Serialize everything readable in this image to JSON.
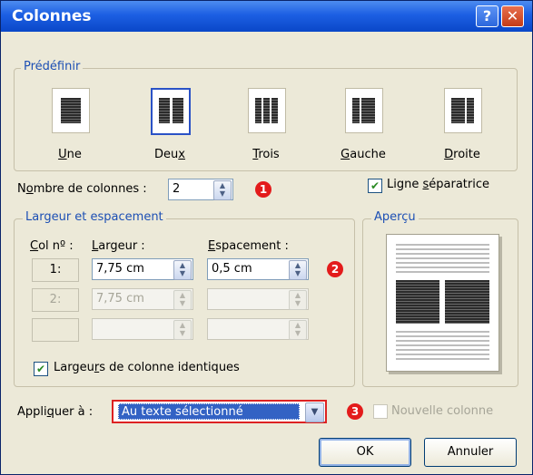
{
  "window": {
    "title": "Colonnes",
    "help_label": "?",
    "close_label": "✕"
  },
  "presets": {
    "group_title": "Prédéfinir",
    "items": [
      {
        "label_u": "U",
        "label_rest": "ne"
      },
      {
        "label_pre": "Deu",
        "label_u": "x",
        "selected": true
      },
      {
        "label_u": "T",
        "label_rest": "rois"
      },
      {
        "label_u": "G",
        "label_rest": "auche"
      },
      {
        "label_u": "D",
        "label_rest": "roite"
      }
    ]
  },
  "num_columns": {
    "label_pre": "N",
    "label_u": "o",
    "label_rest": "mbre de colonnes :",
    "value": "2"
  },
  "separator": {
    "label_pre": "Ligne ",
    "label_u": "s",
    "label_rest": "éparatrice",
    "checked": true
  },
  "width_spacing": {
    "group_title": "Largeur et espacement",
    "col_header_u": "C",
    "col_header_rest": "ol nº :",
    "width_header_u": "L",
    "width_header_rest": "argeur :",
    "spacing_header_u": "E",
    "spacing_header_rest": "spacement :",
    "rows": [
      {
        "col": "1:",
        "width": "7,75 cm",
        "spacing": "0,5 cm",
        "enabled": true
      },
      {
        "col": "2:",
        "width": "7,75 cm",
        "spacing": "",
        "enabled": false
      },
      {
        "col": "",
        "width": "",
        "spacing": "",
        "enabled": false
      }
    ],
    "equal_width": {
      "label_pre": "Largeu",
      "label_u": "r",
      "label_rest": "s de colonne identiques",
      "checked": true
    }
  },
  "preview": {
    "group_title": "Aperçu"
  },
  "apply": {
    "label_pre": "Appli",
    "label_u": "q",
    "label_rest": "uer à :",
    "value": "Au texte sélectionné"
  },
  "new_column": {
    "label": "Nouvelle colonne",
    "checked": false
  },
  "markers": [
    "1",
    "2",
    "3"
  ],
  "buttons": {
    "ok": "OK",
    "cancel": "Annuler"
  },
  "colors": {
    "titlebar": "#1c5fe3",
    "accent_marker": "#e31b1b",
    "group_title": "#1c4fb4"
  }
}
